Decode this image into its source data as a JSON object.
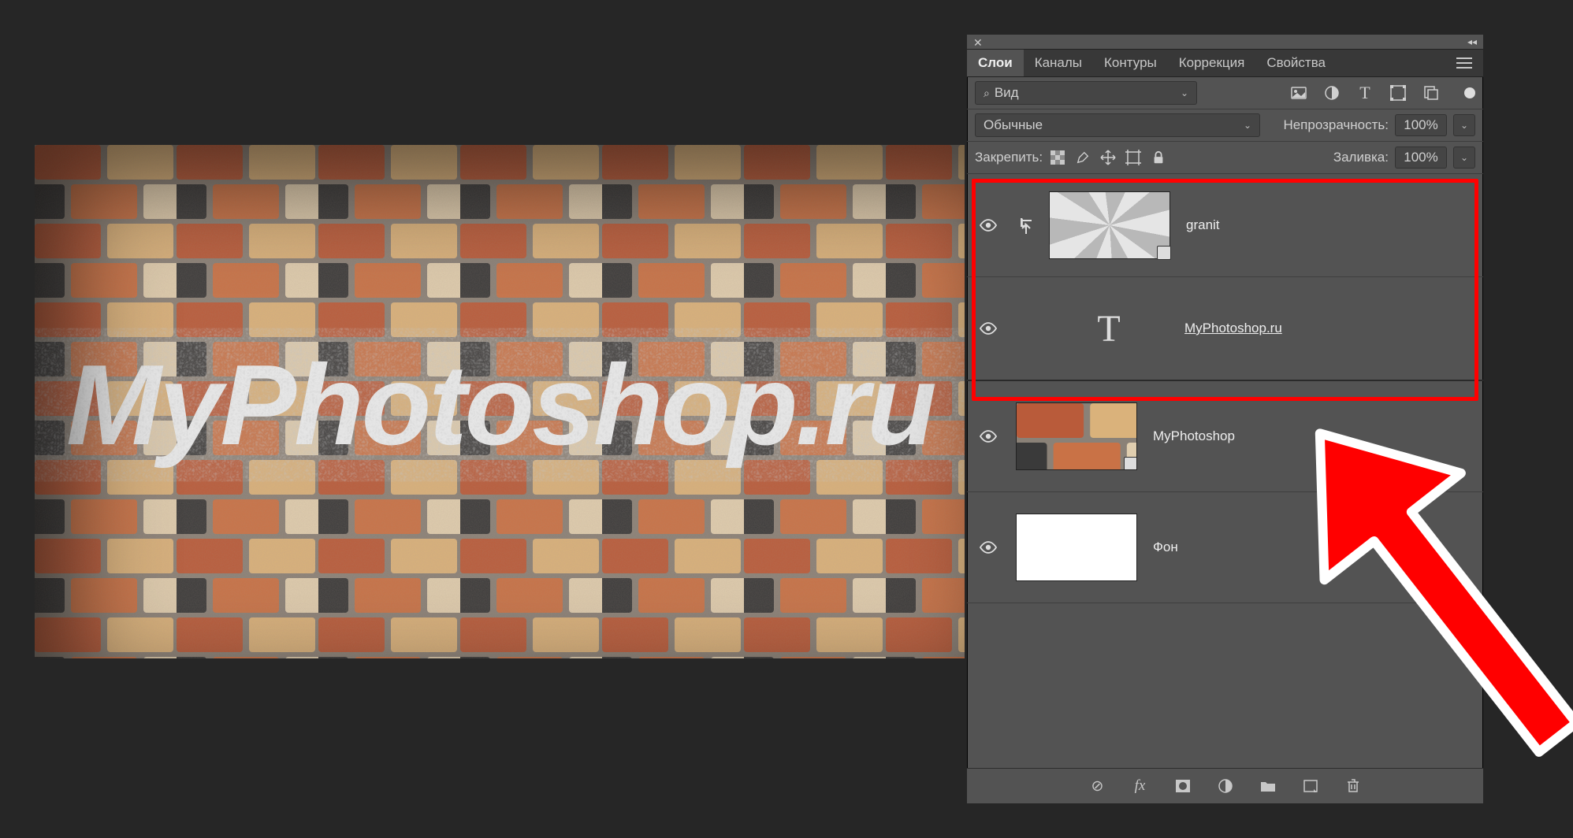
{
  "canvas": {
    "text": "MyPhotoshop.ru"
  },
  "panel": {
    "tabs": [
      "Слои",
      "Каналы",
      "Контуры",
      "Коррекция",
      "Свойства"
    ],
    "active_tab": 0,
    "filter_select": "Вид",
    "blend_mode": "Обычные",
    "opacity_label": "Непрозрачность:",
    "opacity_value": "100%",
    "lock_label": "Закрепить:",
    "fill_label": "Заливка:",
    "fill_value": "100%"
  },
  "layers": [
    {
      "visible": true,
      "clipped": true,
      "thumb": "granite",
      "smart": true,
      "name": "granit"
    },
    {
      "visible": true,
      "thumb": "text",
      "name": "MyPhotoshop.ru",
      "underline": true
    },
    {
      "visible": true,
      "thumb": "bricks",
      "smart": true,
      "name": "MyPhotoshop"
    },
    {
      "visible": true,
      "thumb": "white",
      "name": "Фон"
    }
  ]
}
